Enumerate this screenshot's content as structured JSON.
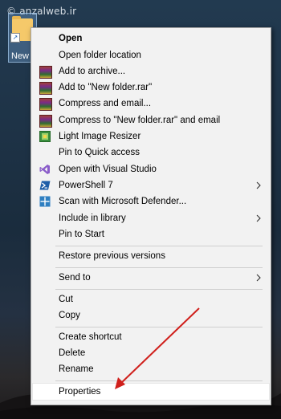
{
  "watermark": "© anzalweb.ir",
  "desktop": {
    "icon_label": "New"
  },
  "menu": {
    "items": [
      {
        "label": "Open"
      },
      {
        "label": "Open folder location"
      },
      {
        "label": "Add to archive..."
      },
      {
        "label": "Add to \"New folder.rar\""
      },
      {
        "label": "Compress and email..."
      },
      {
        "label": "Compress to \"New folder.rar\" and email"
      },
      {
        "label": "Light Image Resizer"
      },
      {
        "label": "Pin to Quick access"
      },
      {
        "label": "Open with Visual Studio"
      },
      {
        "label": "PowerShell 7"
      },
      {
        "label": "Scan with Microsoft Defender..."
      },
      {
        "label": "Include in library"
      },
      {
        "label": "Pin to Start"
      },
      {
        "label": "Restore previous versions"
      },
      {
        "label": "Send to"
      },
      {
        "label": "Cut"
      },
      {
        "label": "Copy"
      },
      {
        "label": "Create shortcut"
      },
      {
        "label": "Delete"
      },
      {
        "label": "Rename"
      },
      {
        "label": "Properties"
      }
    ]
  },
  "colors": {
    "annotation_arrow": "#d0201c",
    "menu_bg": "#f2f2f2",
    "visual_studio": "#8a5cc9",
    "powershell": "#1f5ea8",
    "defender": "#2f7fc1"
  }
}
